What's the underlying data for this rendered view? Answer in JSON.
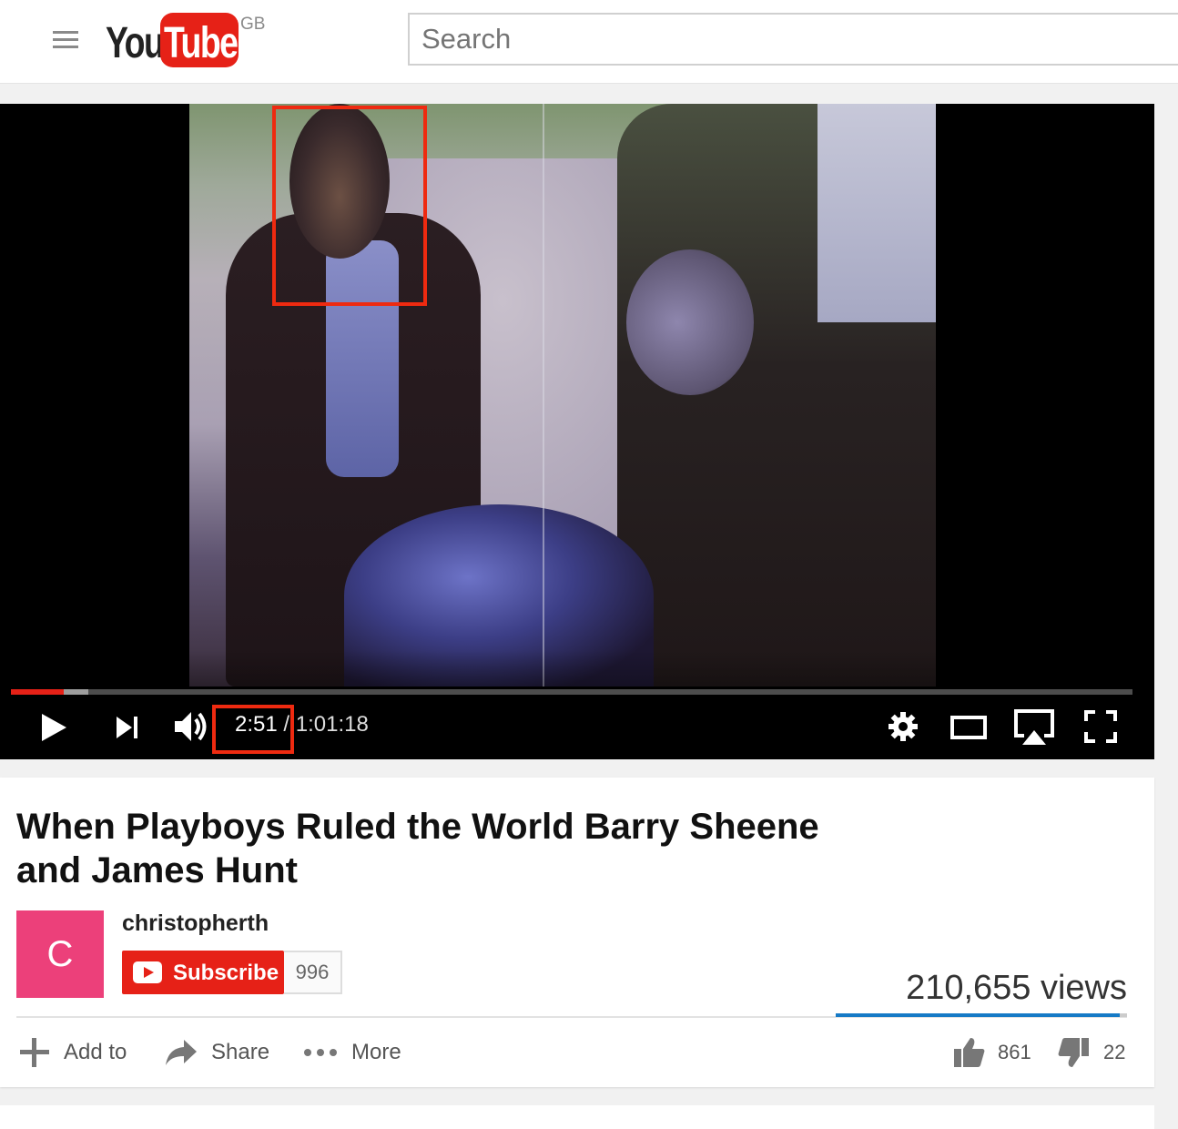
{
  "header": {
    "logo_text_you": "You",
    "logo_text_tube": "Tube",
    "region": "GB",
    "search_placeholder": "Search"
  },
  "player": {
    "current_time": "2:51",
    "separator": " / ",
    "duration": "1:01:18",
    "played_fraction": 0.047,
    "loaded_fraction": 0.069
  },
  "video": {
    "title": "When Playboys Ruled the World Barry Sheene and James Hunt",
    "views": "210,655 views",
    "likes": "861",
    "dislikes": "22",
    "like_ratio": 0.975
  },
  "channel": {
    "avatar_letter": "C",
    "name": "christopherth",
    "subscribe_label": "Subscribe",
    "subscriber_count": "996"
  },
  "actions": {
    "add_to": "Add to",
    "share": "Share",
    "more": "More"
  },
  "colors": {
    "brand_red": "#e62117",
    "highlight_red": "#ee2a10",
    "like_bar_blue": "#167ac6",
    "avatar_pink": "#ec407a"
  }
}
